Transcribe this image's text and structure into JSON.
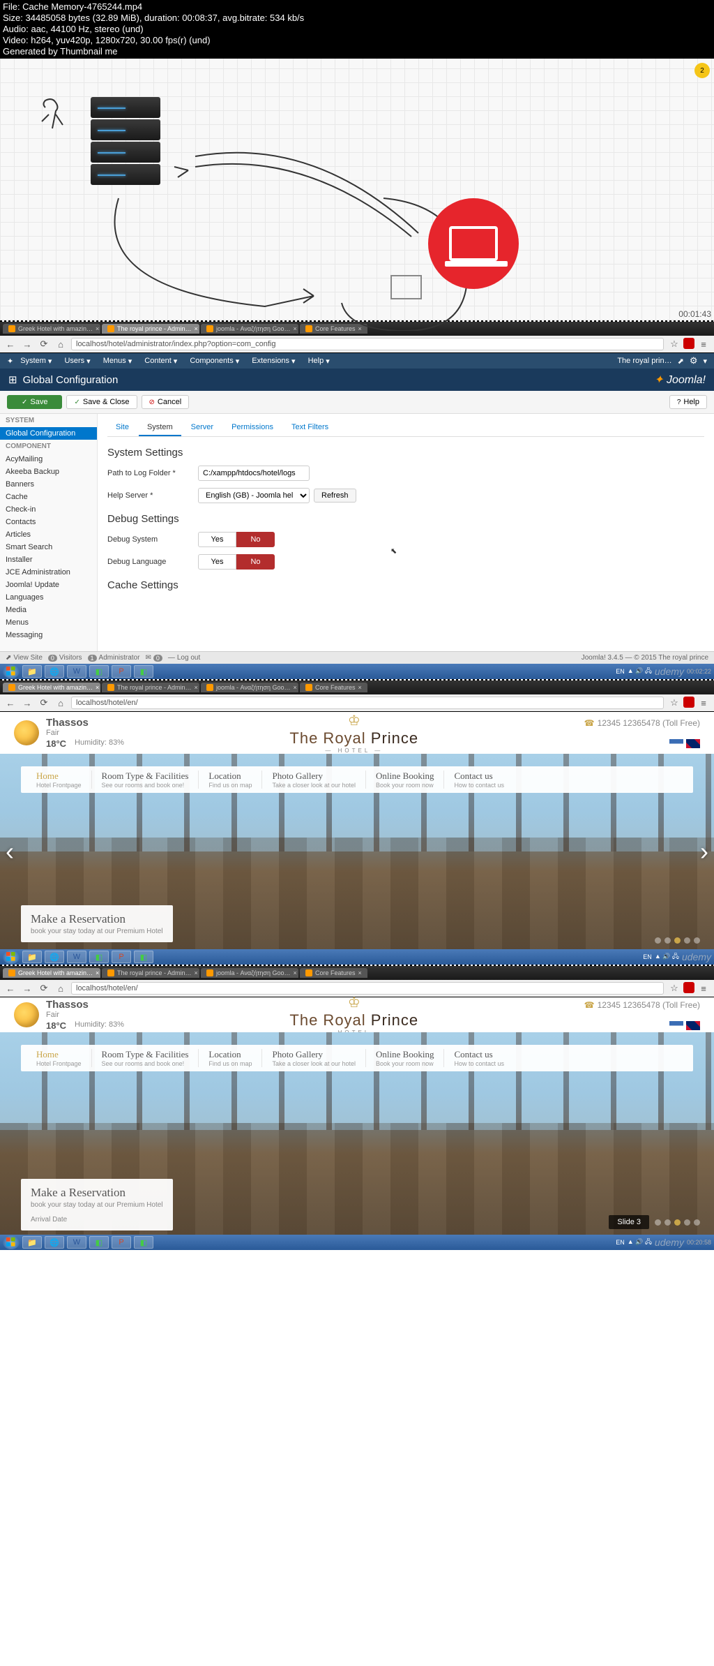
{
  "video_info": {
    "file": "File: Cache Memory-4765244.mp4",
    "size": "Size: 34485058 bytes (32.89 MiB), duration: 00:08:37, avg.bitrate: 534 kb/s",
    "audio": "Audio: aac, 44100 Hz, stereo (und)",
    "video": "Video: h264, yuv420p, 1280x720, 30.00 fps(r) (und)",
    "generated": "Generated by Thumbnail me"
  },
  "diagram": {
    "badge": "2",
    "timestamp": "00:01:43"
  },
  "browser": {
    "tabs": [
      {
        "label": "Greek Hotel with amazin…"
      },
      {
        "label": "The royal prince - Admin…"
      },
      {
        "label": "joomla - Αναζήτηση Goo…"
      },
      {
        "label": "Core Features"
      }
    ],
    "url_admin": "localhost/hotel/administrator/index.php?option=com_config",
    "url_front": "localhost/hotel/en/"
  },
  "joomla": {
    "menu": [
      "System",
      "Users",
      "Menus",
      "Content",
      "Components",
      "Extensions",
      "Help"
    ],
    "site_name": "The royal prin…",
    "page_title": "Global Configuration",
    "logo": "Joomla!",
    "toolbar": {
      "save": "Save",
      "save_close": "Save & Close",
      "cancel": "Cancel",
      "help": "Help"
    },
    "sidebar": {
      "system_heading": "SYSTEM",
      "system_items": [
        "Global Configuration"
      ],
      "component_heading": "COMPONENT",
      "component_items": [
        "AcyMailing",
        "Akeeba Backup",
        "Banners",
        "Cache",
        "Check-in",
        "Contacts",
        "Articles",
        "Smart Search",
        "Installer",
        "JCE Administration",
        "Joomla! Update",
        "Languages",
        "Media",
        "Menus",
        "Messaging"
      ]
    },
    "tabs": [
      "Site",
      "System",
      "Server",
      "Permissions",
      "Text Filters"
    ],
    "active_tab": "System",
    "sections": {
      "system_settings": "System Settings",
      "debug_settings": "Debug Settings",
      "cache_settings": "Cache Settings"
    },
    "fields": {
      "path_label": "Path to Log Folder *",
      "path_value": "C:/xampp/htdocs/hotel/logs",
      "help_label": "Help Server *",
      "help_value": "English (GB) - Joomla help wiki",
      "refresh": "Refresh",
      "debug_system": "Debug System",
      "debug_language": "Debug Language",
      "yes": "Yes",
      "no": "No"
    },
    "footer": {
      "view_site": "View Site",
      "visitors": "Visitors",
      "visitors_count": "0",
      "admin": "Administrator",
      "admin_count": "1",
      "msg_count": "0",
      "logout": "Log out",
      "copyright": "Joomla! 3.4.5 — © 2015 The royal prince"
    }
  },
  "taskbar": {
    "lang": "EN",
    "time1": "00:02:22",
    "time2": "00:20:58",
    "udemy": "udemy"
  },
  "hotel": {
    "weather": {
      "location": "Thassos",
      "condition": "Fair",
      "temp": "18°C",
      "humidity": "Humidity: 83%"
    },
    "name_first": "The Royal ",
    "name_last": "Prince",
    "subtitle": "— HOTEL —",
    "phone": "12345 12365478 (Toll Free)",
    "nav": [
      {
        "title": "Home",
        "sub": "Hotel Frontpage"
      },
      {
        "title": "Room Type & Facilities",
        "sub": "See our rooms and book one!"
      },
      {
        "title": "Location",
        "sub": "Find us on map"
      },
      {
        "title": "Photo Gallery",
        "sub": "Take a closer look at our hotel"
      },
      {
        "title": "Online Booking",
        "sub": "Book your room now"
      },
      {
        "title": "Contact us",
        "sub": "How to contact us"
      }
    ],
    "reservation": {
      "title": "Make a Reservation",
      "subtitle": "book your stay today at our Premium Hotel",
      "arrival_label": "Arrival Date"
    },
    "slide": "Slide 3"
  }
}
